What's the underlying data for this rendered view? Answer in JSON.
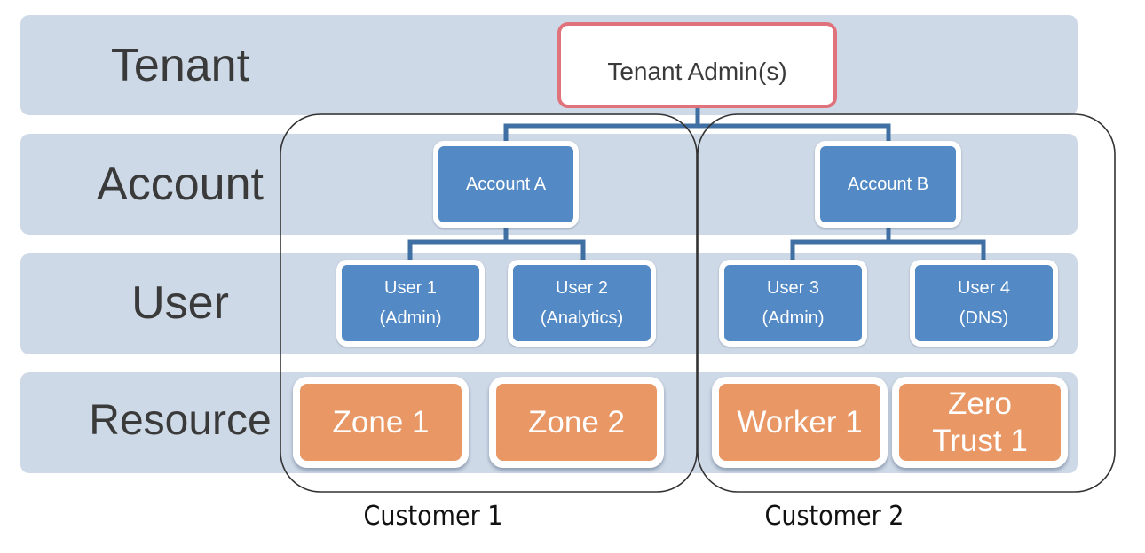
{
  "levels": [
    {
      "label": "Tenant"
    },
    {
      "label": "Account"
    },
    {
      "label": "User"
    },
    {
      "label": "Resource"
    }
  ],
  "tenant_admin": {
    "label": "Tenant Admin(s)"
  },
  "customers": [
    {
      "label": "Customer 1",
      "account": {
        "label": "Account A"
      },
      "users": [
        {
          "line1": "User 1",
          "line2": "(Admin)"
        },
        {
          "line1": "User 2",
          "line2": "(Analytics)"
        }
      ],
      "resources": [
        {
          "line1": "Zone 1",
          "line2": ""
        },
        {
          "line1": "Zone 2",
          "line2": ""
        }
      ]
    },
    {
      "label": "Customer 2",
      "account": {
        "label": "Account B"
      },
      "users": [
        {
          "line1": "User 3",
          "line2": "(Admin)"
        },
        {
          "line1": "User 4",
          "line2": "(DNS)"
        }
      ],
      "resources": [
        {
          "line1": "Worker 1",
          "line2": ""
        },
        {
          "line1": "Zero",
          "line2": "Trust 1"
        }
      ]
    }
  ],
  "colors": {
    "band": "#ced9e7",
    "account_user_node": "#538ac5",
    "resource_node": "#e89765",
    "tenant_admin_border": "#e0727b",
    "connector": "#3f6fa3"
  }
}
